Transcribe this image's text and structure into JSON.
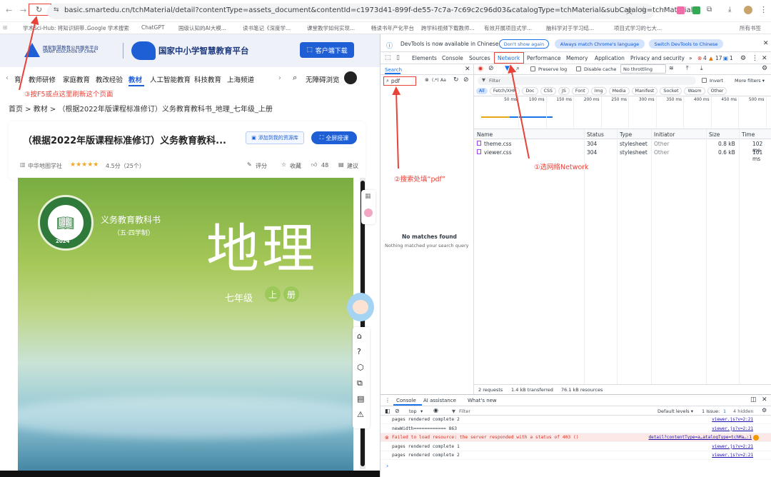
{
  "browser": {
    "url": "basic.smartedu.cn/tchMaterial/detail?contentType=assets_document&contentId=c1973d41-899f-de55-7c7a-7c69c2c96d03&catalogType=tchMaterial&subCatalog=tchMaterial",
    "bookmarks": [
      "学术Sci-Hub: 将知识研带...",
      "Google 学术搜索",
      "ChatGPT",
      "国级认知的AI大模...",
      "读书笔记《深度学...",
      "课堂教学如何实现...",
      "畅读书年产化平台",
      "跨学科视频下载教师...",
      "有效开展项目式学...",
      "脑科学对于学习结...",
      "项目式学习的七大..."
    ],
    "all_bookmarks": "所有书签"
  },
  "site": {
    "logo1_line1": "国家智慧教育公共服务平台",
    "logo1_line2": "SMART EDUCATION OF CHINA",
    "logo2": "国家中小学智慧教育平台",
    "download_btn": "客户端下载",
    "nav": [
      "育",
      "教师研修",
      "家庭教育",
      "教改经验",
      "教材",
      "人工智能教育",
      "科技教育",
      "上海频道"
    ],
    "accessibility": "无障碍浏览",
    "breadcrumb": "首页 > 教材 > （根据2022年版课程标准修订）义务教育教科书_地理_七年级_上册",
    "title": "（根据2022年版课程标准修订）义务教育教科...",
    "add_btn": "添加到我的资源库",
    "fullscreen_btn": "全屏授课",
    "publisher": "中华地图学社",
    "stars": "★★★★★",
    "rating": "4.5分（25个）",
    "rate_label": "评分",
    "fav_label": "收藏",
    "likes": "48",
    "suggest_label": "建议",
    "cover": {
      "series": "义务教育教科书",
      "system": "（五·四学制）",
      "subject": "地理",
      "grade": "七年级",
      "vol1": "上",
      "vol2": "册",
      "seal_year": "2024"
    }
  },
  "annotations": {
    "a1": "①选网络Network",
    "a2": "②搜索处填“pdf”",
    "a3": "③按F5或点这里刷新这个页面"
  },
  "devtools": {
    "banner": "DevTools is now available in Chinese",
    "dont_show": "Don't show again",
    "match_lang": "Always match Chrome's language",
    "switch_lang": "Switch DevTools to Chinese",
    "tabs": [
      "Elements",
      "Console",
      "Sources",
      "Network",
      "Performance",
      "Memory",
      "Application",
      "Privacy and security"
    ],
    "err_count": "4",
    "warn_count": "17",
    "info_count": "1",
    "search_title": "Search",
    "search_value": "pdf",
    "regex_label": "(.*)",
    "case_label": "Aa",
    "no_match_title": "No matches found",
    "no_match_sub": "Nothing matched your search query",
    "preserve_log": "Preserve log",
    "disable_cache": "Disable cache",
    "throttling": "No throttling",
    "filter_placeholder": "Filter",
    "invert": "Invert",
    "more_filters": "More filters ▾",
    "type_filters": [
      "All",
      "Fetch/XHR",
      "Doc",
      "CSS",
      "JS",
      "Font",
      "Img",
      "Media",
      "Manifest",
      "Socket",
      "Wasm",
      "Other"
    ],
    "timeline_ticks": [
      "50 ms",
      "100 ms",
      "150 ms",
      "200 ms",
      "250 ms",
      "300 ms",
      "350 ms",
      "400 ms",
      "450 ms",
      "500 ms"
    ],
    "columns": [
      "Name",
      "Status",
      "Type",
      "Initiator",
      "Size",
      "Time"
    ],
    "rows": [
      {
        "name": "theme.css",
        "status": "304",
        "type": "stylesheet",
        "initiator": "Other",
        "size": "0.8 kB",
        "time": "102 ms"
      },
      {
        "name": "viewer.css",
        "status": "304",
        "type": "stylesheet",
        "initiator": "Other",
        "size": "0.6 kB",
        "time": "101 ms"
      }
    ],
    "status_requests": "2 requests",
    "status_transferred": "1.4 kB transferred",
    "status_resources": "76.1 kB resources",
    "drawer_tabs": [
      "Console",
      "AI assistance",
      "What's new"
    ],
    "context": "top",
    "log_levels": "Default levels ▾",
    "issues": "1 Issue:",
    "issues_count": "1",
    "hidden": "4 hidden",
    "console": [
      {
        "msg": "pages rendered complete 2",
        "src": "viewer.js?v=2:21",
        "err": false
      },
      {
        "msg": "newWidth============ 863",
        "src": "viewer.js?v=2:21",
        "err": false
      },
      {
        "msg": "Failed to load resource: the server responded with a status of 403 ()",
        "src": "detail?contentType=a…atalogType=tchMa…:1",
        "err": true
      },
      {
        "msg": "pages rendered complete 1",
        "src": "viewer.js?v=2:21",
        "err": false
      },
      {
        "msg": "pages rendered complete 2",
        "src": "viewer.js?v=2:21",
        "err": false
      }
    ]
  },
  "colors": {
    "accent": "#1a73e8",
    "site_blue": "#1f5fd6",
    "annotation": "#e8433b",
    "error": "#d93025"
  }
}
